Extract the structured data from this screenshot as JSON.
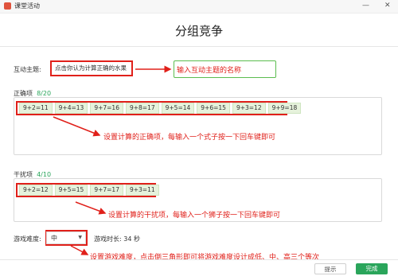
{
  "window": {
    "title": "课堂活动",
    "minimize": "—",
    "close": "✕"
  },
  "page": {
    "title": "分组竞争"
  },
  "topic": {
    "label": "互动主题:",
    "value": "点击你认为计算正确的水果",
    "annotation": "输入互动主题的名称"
  },
  "correct": {
    "label": "正确项",
    "count": "8/20",
    "items": [
      "9+2=11",
      "9+4=13",
      "9+7=16",
      "9+8=17",
      "9+5=14",
      "9+6=15",
      "9+3=12",
      "9+9=18"
    ],
    "annotation": "设置计算的正确项，每输入一个式子按一下回车键即可"
  },
  "distractor": {
    "label": "干扰项",
    "count": "4/10",
    "items": [
      "9+2=12",
      "9+5=15",
      "9+7=17",
      "9+3=11"
    ],
    "annotation": "设置计算的干扰项，每输入一个狮子按一下回车键即可"
  },
  "difficulty": {
    "label": "游戏难度:",
    "value": "中",
    "duration_label": "游戏时长: 34 秒",
    "annotation": "设置游戏难度，点击倒三角形即可将游戏难度设计成低、中、高三个等次"
  },
  "footer": {
    "hint_button": "提示",
    "done_button": "完成"
  },
  "colors": {
    "accent": "#2aa55b",
    "annotation": "#e0201a",
    "chip_bg": "#e6f2dc"
  }
}
